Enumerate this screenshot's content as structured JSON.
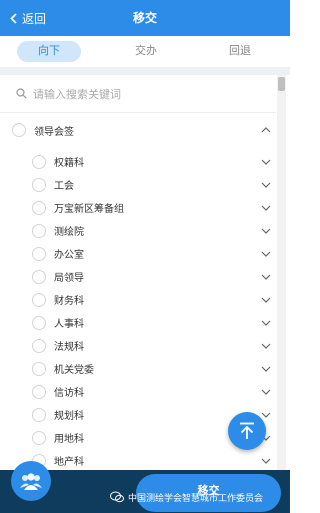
{
  "header": {
    "back_label": "返回",
    "title": "移交"
  },
  "tabs": [
    {
      "label": "向下",
      "active": true
    },
    {
      "label": "交办",
      "active": false
    },
    {
      "label": "回退",
      "active": false
    }
  ],
  "search": {
    "placeholder": "请输入搜索关键词"
  },
  "group": {
    "label": "领导会签",
    "expanded": true
  },
  "items": [
    {
      "label": "权籍科"
    },
    {
      "label": "工会"
    },
    {
      "label": "万宝新区筹备组"
    },
    {
      "label": "测绘院"
    },
    {
      "label": "办公室"
    },
    {
      "label": "局领导"
    },
    {
      "label": "财务科"
    },
    {
      "label": "人事科"
    },
    {
      "label": "法规科"
    },
    {
      "label": "机关党委"
    },
    {
      "label": "信访科"
    },
    {
      "label": "规划科"
    },
    {
      "label": "用地科"
    },
    {
      "label": "地产科"
    }
  ],
  "footer": {
    "submit_label": "移交"
  },
  "watermark": {
    "text": "中国测绘学会智慧城市工作委员会"
  },
  "colors": {
    "primary": "#2d8ce8",
    "bottom_bar": "#0f3b5d",
    "tab_active_bg": "#cfe6fb"
  }
}
